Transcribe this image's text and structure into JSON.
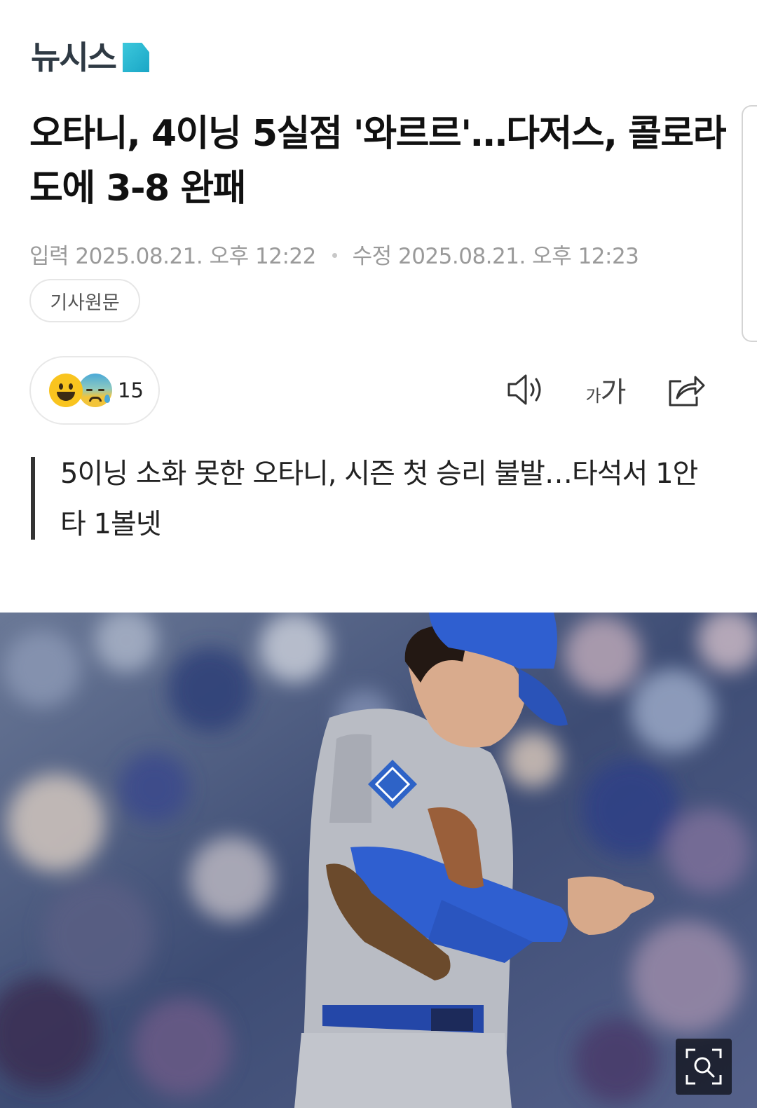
{
  "header": {
    "logo_text": "뉴시스",
    "brand_color": "#25b4d0"
  },
  "article": {
    "headline": "오타니, 4이닝 5실점 '와르르'…다저스, 콜로라도에 3-8 완패",
    "published_label": "입력",
    "published_time": "2025.08.21. 오후 12:22",
    "modified_label": "수정",
    "modified_time": "2025.08.21. 오후 12:23",
    "original_link_label": "기사원문",
    "subheadline": "5이닝 소화 못한 오타니, 시즌 첫 승리 불발…타석서 1안타 1볼넷"
  },
  "reactions": {
    "icons": [
      "smile-emoji-icon",
      "sad-sweat-emoji-icon"
    ],
    "count": "15"
  },
  "toolbar": {
    "speaker_icon": "speaker-icon",
    "font_size_small": "가",
    "font_size_large": "가",
    "share_icon": "share-icon"
  },
  "photo": {
    "zoom_icon": "zoom-search-icon"
  }
}
